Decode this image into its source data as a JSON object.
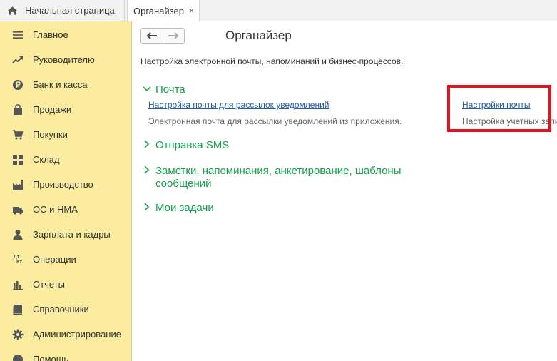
{
  "tabs": {
    "home": {
      "label": "Начальная страница",
      "icon": "home-icon"
    },
    "active": {
      "label": "Органайзер",
      "close": "×"
    }
  },
  "sidebar": {
    "items": [
      {
        "label": "Главное",
        "icon": "menu-icon"
      },
      {
        "label": "Руководителю",
        "icon": "trend-icon"
      },
      {
        "label": "Банк и касса",
        "icon": "ruble-icon"
      },
      {
        "label": "Продажи",
        "icon": "bag-icon"
      },
      {
        "label": "Покупки",
        "icon": "cart-icon"
      },
      {
        "label": "Склад",
        "icon": "warehouse-icon"
      },
      {
        "label": "Производство",
        "icon": "factory-icon"
      },
      {
        "label": "ОС и НМА",
        "icon": "truck-icon"
      },
      {
        "label": "Зарплата и кадры",
        "icon": "person-icon"
      },
      {
        "label": "Операции",
        "icon": "dt-kt-icon"
      },
      {
        "label": "Отчеты",
        "icon": "bar-chart-icon"
      },
      {
        "label": "Справочники",
        "icon": "book-icon"
      },
      {
        "label": "Администрирование",
        "icon": "gear-icon"
      },
      {
        "label": "Помощь",
        "icon": "help-icon"
      }
    ],
    "dtkt": {
      "top": "Дт",
      "bottom": "Кт"
    }
  },
  "main": {
    "title": "Органайзер",
    "description": "Настройка электронной почты, напоминаний и бизнес-процессов.",
    "nav": {
      "back": "🡐",
      "forward": "🡒"
    },
    "sections": [
      {
        "title": "Почта",
        "expanded": true
      },
      {
        "title": "Отправка SMS",
        "expanded": false
      },
      {
        "title_line1": "Заметки, напоминания, анкетирование, шаблоны",
        "title_line2": "сообщений",
        "expanded": false
      },
      {
        "title": "Мои задачи",
        "expanded": false
      }
    ],
    "mail": {
      "link1": "Настройка почты для рассылок уведомлений",
      "desc1": "Электронная почта для рассылки уведомлений из приложения.",
      "link2": "Настройки почты",
      "desc2": "Настройка учетных запис"
    },
    "chevron_open": "∨",
    "chevron_closed": "›"
  },
  "colors": {
    "sidebar_bg": "#fbeca0",
    "section_green": "#14a04c",
    "link_blue": "#1d5fb8",
    "highlight_red": "#e0131f"
  }
}
